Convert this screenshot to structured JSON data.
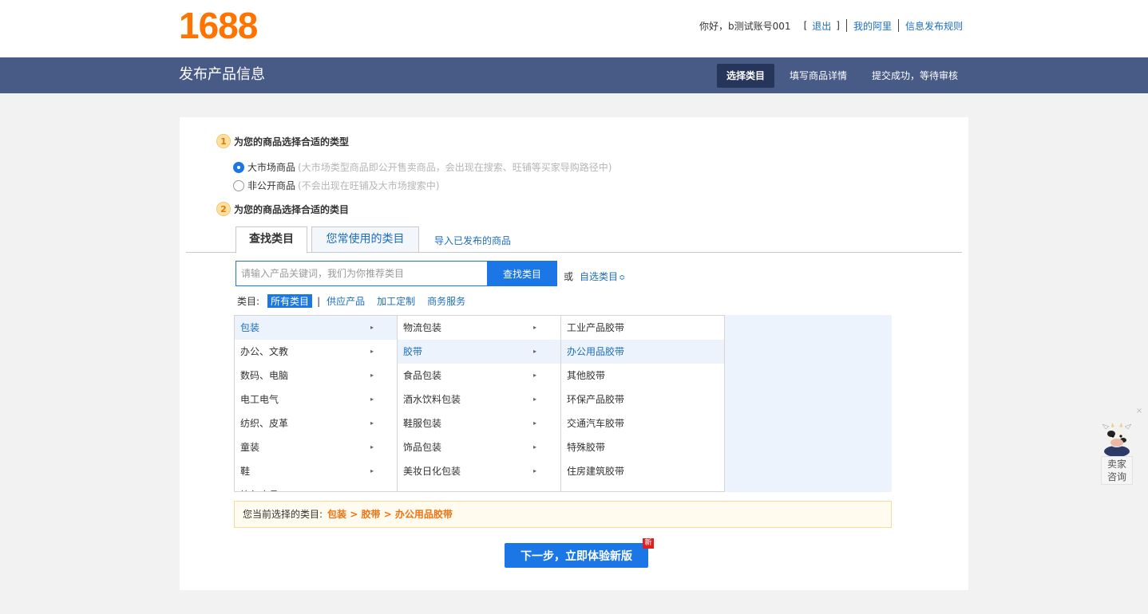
{
  "header": {
    "logo": "1688",
    "greeting": "你好，b测试账号001",
    "bracket_open": "[",
    "logout": "退出",
    "bracket_close": "]",
    "my_alibaba": "我的阿里",
    "rules": "信息发布规则"
  },
  "band": {
    "title": "发布产品信息",
    "steps": [
      "选择类目",
      "填写商品详情",
      "提交成功，等待审核"
    ],
    "active_step": "选择类目"
  },
  "section1": {
    "number": "1",
    "title": "为您的商品选择合适的类型",
    "options": [
      {
        "label": "大市场商品",
        "note": "(大市场类型商品即公开售卖商品，会出现在搜索、旺铺等买家导购路径中)",
        "checked": true
      },
      {
        "label": "非公开商品",
        "note": "(不会出现在旺铺及大市场搜索中)",
        "checked": false
      }
    ]
  },
  "section2": {
    "number": "2",
    "title": "为您的商品选择合适的类目"
  },
  "tabs": {
    "find": "查找类目",
    "frequent": "您常使用的类目",
    "import": "导入已发布的商品"
  },
  "search": {
    "placeholder": "请输入产品关键词，我们为你推荐类目",
    "value": "",
    "button": "查找类目",
    "or": "或",
    "custom": "自选类目",
    "custom_icon": "double-chevron-up-icon"
  },
  "filter": {
    "label": "类目:",
    "options": [
      "所有类目",
      "供应产品",
      "加工定制",
      "商务服务"
    ],
    "selected": "所有类目",
    "separator": "|"
  },
  "columns": {
    "col1": [
      "包装",
      "办公、文教",
      "数码、电脑",
      "电工电气",
      "纺织、皮革",
      "童装",
      "鞋",
      "箱包皮具"
    ],
    "col1_selected": 0,
    "col2": [
      "物流包装",
      "胶带",
      "食品包装",
      "酒水饮料包装",
      "鞋服包装",
      "饰品包装",
      "美妆日化包装"
    ],
    "col2_selected": 1,
    "col3": [
      "工业产品胶带",
      "办公用品胶带",
      "其他胶带",
      "环保产品胶带",
      "交通汽车胶带",
      "特殊胶带",
      "住房建筑胶带"
    ],
    "col3_selected": 1,
    "arrow": "▸"
  },
  "current": {
    "label": "您当前选择的类目:",
    "path": "包装 > 胶带 > 办公用品胶带"
  },
  "next": {
    "label": "下一步，立即体验新版",
    "badge": "新"
  },
  "widget": {
    "line1": "卖家",
    "line2": "咨询",
    "close": "×",
    "icon": "cow-mascot-icon"
  },
  "colors": {
    "brand_orange": "#ff7300",
    "band": "#485b87",
    "active_step": "#26365a",
    "primary_blue": "#1b77e5",
    "link_blue": "#1c6dbe",
    "path_orange": "#f17313"
  }
}
